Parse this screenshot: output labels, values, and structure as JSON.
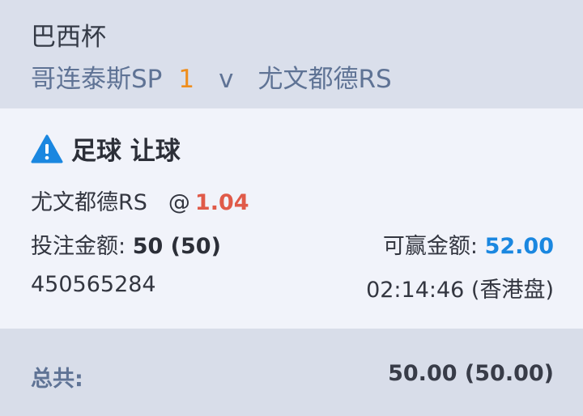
{
  "header": {
    "league": "巴西杯",
    "home_team": "哥连泰斯SP",
    "score": "1",
    "vs": "v",
    "away_team": "尤文都德RS"
  },
  "bet": {
    "title": "足球 让球",
    "selection": "尤文都德RS",
    "at": "@",
    "odds": "1.04",
    "stake_label": "投注金额: ",
    "stake_value": "50 (50)",
    "win_label": "可赢金额: ",
    "win_value": "52.00",
    "ticket_id": "450565284",
    "time": "02:14:46 (香港盘)"
  },
  "footer": {
    "total_label": "总共:",
    "total_value": "50.00 (50.00)"
  },
  "colors": {
    "score": "#ef8e1c",
    "odds": "#e05a49",
    "win": "#1a87e0",
    "warning_icon": "#1a87e0"
  },
  "icons": {
    "bet_title": "warning-icon"
  }
}
